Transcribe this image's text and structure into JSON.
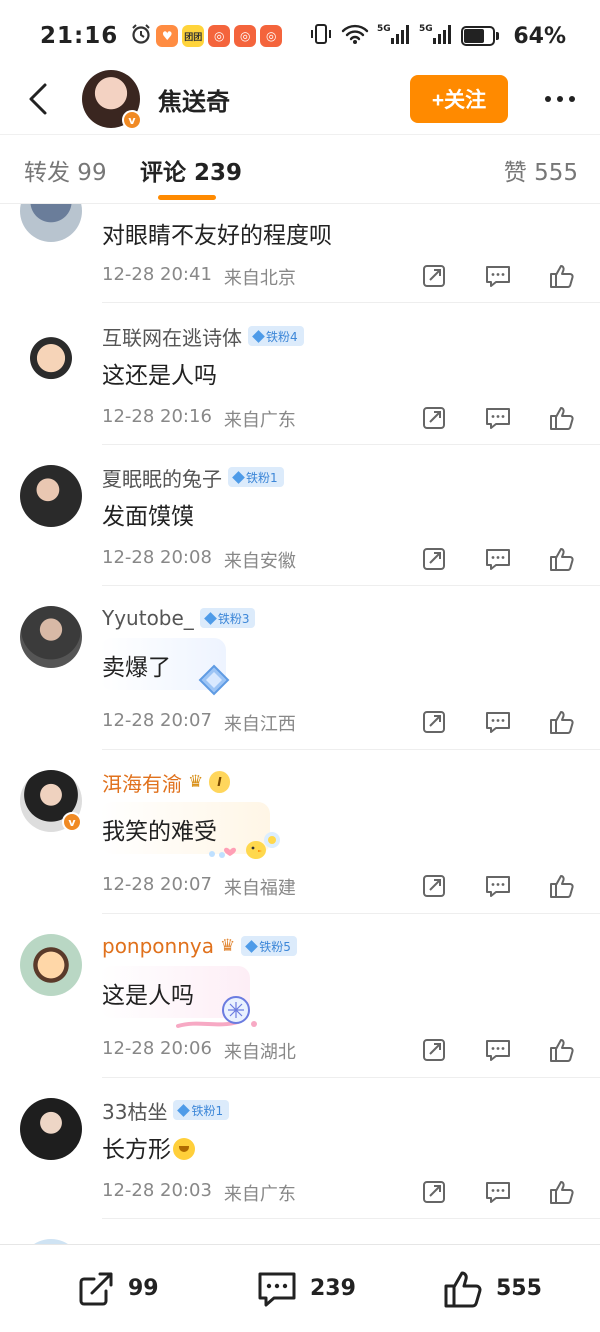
{
  "status_bar": {
    "time": "21:16",
    "battery": "64%",
    "battery_fraction": 0.64,
    "app_icon_label": "团团"
  },
  "header": {
    "user_name": "焦送奇",
    "follow_label": "+关注"
  },
  "tabs": {
    "repost": "转发 99",
    "comments": "评论 239",
    "likes": "赞 555"
  },
  "comments": [
    {
      "user": "",
      "badge": "",
      "text": "对眼睛不友好的程度呗",
      "time": "12-28 20:41",
      "location": "来自北京"
    },
    {
      "user": "互联网在逃诗体",
      "badge": "铁粉4",
      "text": "这还是人吗",
      "time": "12-28 20:16",
      "location": "来自广东"
    },
    {
      "user": "夏眠眠的兔子",
      "badge": "铁粉1",
      "text": "发面馍馍",
      "time": "12-28 20:08",
      "location": "来自安徽"
    },
    {
      "user": "Yyutobe_",
      "badge": "铁粉3",
      "text": "卖爆了",
      "time": "12-28 20:07",
      "location": "来自江西"
    },
    {
      "user": "洱海有渝",
      "badge": "I",
      "text": "我笑的难受",
      "time": "12-28 20:07",
      "location": "来自福建"
    },
    {
      "user": "ponponnya",
      "badge": "铁粉5",
      "text": "这是人吗",
      "time": "12-28 20:06",
      "location": "来自湖北"
    },
    {
      "user": "33枯坐",
      "badge": "铁粉1",
      "text": "长方形",
      "time": "12-28 20:03",
      "location": "来自广东"
    }
  ],
  "bottom_bar": {
    "repost_count": "99",
    "comment_count": "239",
    "like_count": "555"
  },
  "colors": {
    "accent": "#ff8a00",
    "fan_badge": "#3d87d8",
    "gold_name": "#e0711c"
  }
}
